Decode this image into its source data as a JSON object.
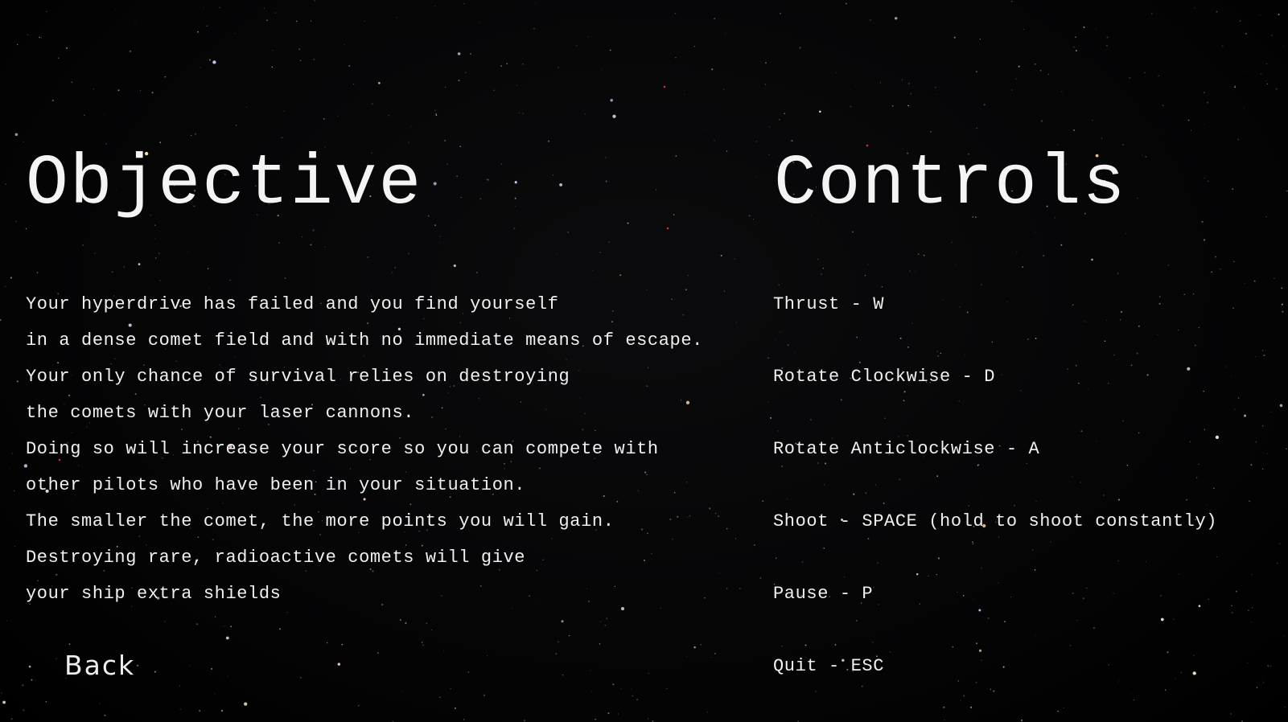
{
  "objective": {
    "heading": "Objective",
    "lines": [
      "Your hyperdrive has failed and you find yourself",
      "in a dense comet field and with no immediate means of escape.",
      "Your only chance of survival relies on destroying",
      "the comets with your laser cannons.",
      "Doing so will increase your score so you can compete with",
      "other pilots who have been in your situation.",
      "The smaller the comet, the more points you will gain.",
      "Destroying rare, radioactive comets will give",
      "your ship extra shields"
    ]
  },
  "controls": {
    "heading": "Controls",
    "items": [
      "Thrust - W",
      "Rotate Clockwise - D",
      "Rotate Anticlockwise - A",
      "Shoot - SPACE (hold to shoot constantly)",
      "Pause - P",
      "Quit - ESC"
    ]
  },
  "back_label": "Back",
  "colors": {
    "background": "#000000",
    "text": "#f0f0f0"
  }
}
